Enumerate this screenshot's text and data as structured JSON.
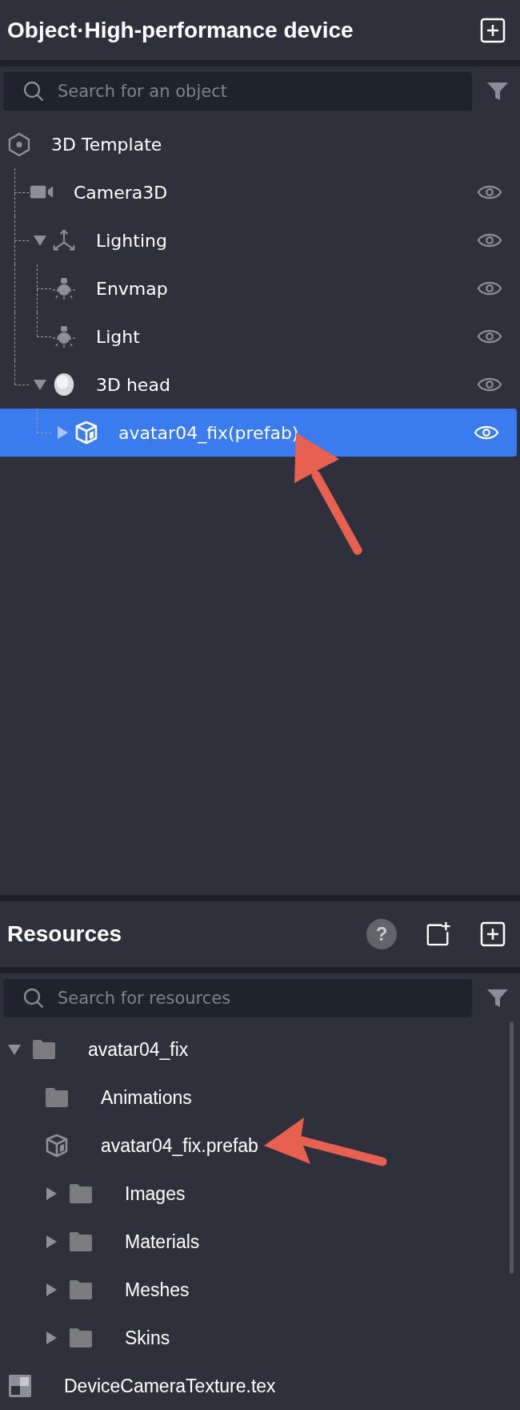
{
  "objects": {
    "title": "Object·High-performance device",
    "search": {
      "placeholder": "Search for an object"
    },
    "tree": [
      {
        "label": "3D Template",
        "kind": "scene",
        "selected": false,
        "annotated": false,
        "children": [
          {
            "label": "Camera3D",
            "kind": "camera",
            "visible": true,
            "selected": false,
            "annotated": false
          },
          {
            "label": "Lighting",
            "kind": "axes",
            "visible": true,
            "expanded": true,
            "selected": false,
            "annotated": false,
            "children": [
              {
                "label": "Envmap",
                "kind": "light",
                "visible": true,
                "selected": false,
                "annotated": false
              },
              {
                "label": "Light",
                "kind": "light",
                "visible": true,
                "selected": false,
                "annotated": false
              }
            ]
          },
          {
            "label": "3D head",
            "kind": "head",
            "visible": true,
            "expanded": true,
            "selected": false,
            "annotated": false,
            "children": [
              {
                "label": "avatar04_fix(prefab)",
                "kind": "prefab",
                "visible": true,
                "expanded": false,
                "selected": true,
                "annotated": true
              }
            ]
          }
        ]
      }
    ]
  },
  "resources": {
    "title": "Resources",
    "help_label": "?",
    "search": {
      "placeholder": "Search for resources"
    },
    "tree": [
      {
        "label": "avatar04_fix",
        "kind": "folder",
        "expanded": true,
        "annotated": false,
        "children": [
          {
            "label": "Animations",
            "kind": "folder",
            "annotated": false
          },
          {
            "label": "avatar04_fix.prefab",
            "kind": "prefab",
            "annotated": true
          },
          {
            "label": "Images",
            "kind": "folder",
            "expanded": false,
            "annotated": false
          },
          {
            "label": "Materials",
            "kind": "folder",
            "expanded": false,
            "annotated": false
          },
          {
            "label": "Meshes",
            "kind": "folder",
            "expanded": false,
            "annotated": false
          },
          {
            "label": "Skins",
            "kind": "folder",
            "expanded": false,
            "annotated": false
          }
        ]
      },
      {
        "label": "DeviceCameraTexture.tex",
        "kind": "texture",
        "annotated": false
      }
    ]
  }
}
